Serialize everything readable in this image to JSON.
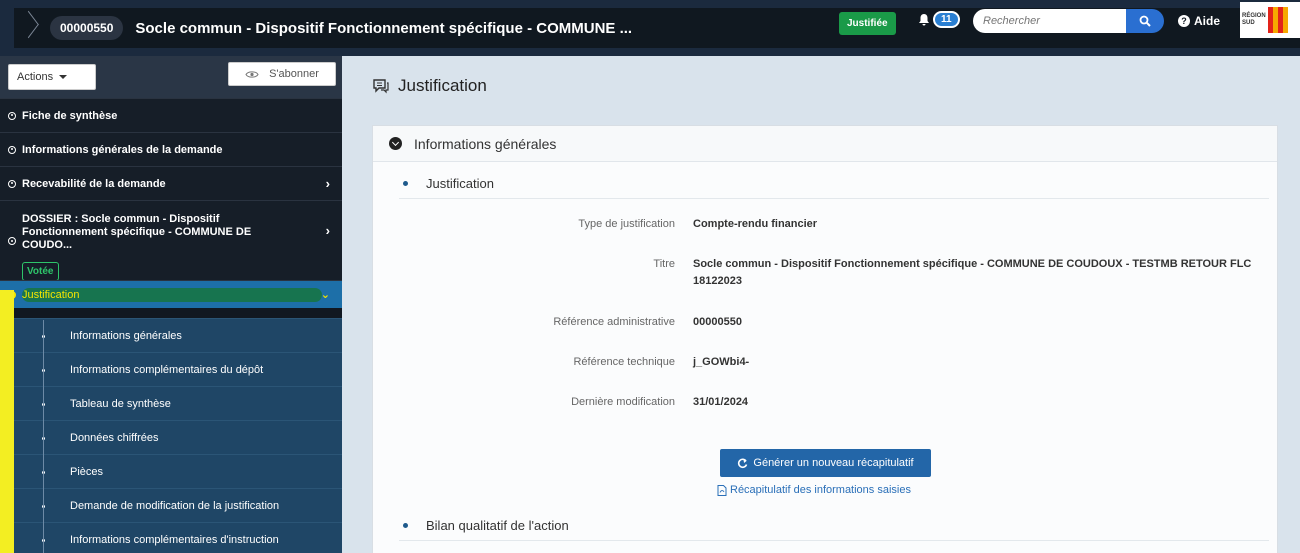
{
  "header": {
    "dossier_number": "00000550",
    "title": "Socle commun - Dispositif Fonctionnement spécifique - COMMUNE ...",
    "status_badge": "Justifiée",
    "notification_count": "11",
    "search_placeholder": "Rechercher",
    "help_label": "Aide",
    "region_logo_text": "RÉGION SUD",
    "icons": {
      "bell": "bell-icon",
      "search": "search-icon",
      "help": "question-circle-icon"
    },
    "colors": {
      "status": "#1a9a48",
      "notif": "#2a7fd2",
      "search_btn": "#2a6fd1"
    }
  },
  "sidebar": {
    "actions_label": "Actions",
    "subscribe_label": "S'abonner",
    "items": [
      {
        "label": "Fiche de synthèse",
        "has_arrow": false
      },
      {
        "label": "Informations générales de la demande",
        "has_arrow": false
      },
      {
        "label": "Recevabilité de la demande",
        "has_arrow": true
      }
    ],
    "dossier": {
      "label": "DOSSIER : Socle commun - Dispositif Fonctionnement spécifique - COMMUNE DE COUDO...",
      "badge": "Votée"
    },
    "active_item": {
      "label": "Justification"
    },
    "sub_items": [
      "Informations générales",
      "Informations complémentaires du dépôt",
      "Tableau de synthèse",
      "Données chiffrées",
      "Pièces",
      "Demande de modification de la justification",
      "Informations complémentaires d'instruction"
    ]
  },
  "main": {
    "page_title": "Justification",
    "panel_title": "Informations générales",
    "section1_title": "Justification",
    "fields": [
      {
        "label": "Type de justification",
        "value": "Compte-rendu financier"
      },
      {
        "label": "Titre",
        "value": "Socle commun - Dispositif Fonctionnement spécifique - COMMUNE DE COUDOUX - TESTMB RETOUR FLC 18122023"
      },
      {
        "label": "Référence administrative",
        "value": "00000550"
      },
      {
        "label": "Référence technique",
        "value": "j_GOWbi4-"
      },
      {
        "label": "Dernière modification",
        "value": "31/01/2024"
      }
    ],
    "generate_button": "Générer un nouveau récapitulatif",
    "recap_link": "Récapitulatif des informations saisies",
    "section2_title": "Bilan qualitatif de l'action"
  }
}
